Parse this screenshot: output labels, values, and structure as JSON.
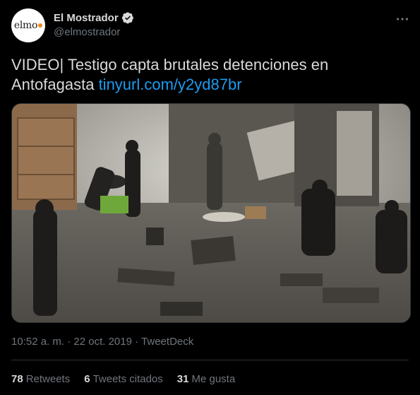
{
  "author": {
    "avatar_text": "elmo",
    "display_name": "El Mostrador",
    "handle": "@elmostrador"
  },
  "tweet": {
    "text": "VIDEO| Testigo capta brutales detenciones en Antofagasta",
    "link": "tinyurl.com/y2yd87br"
  },
  "meta": {
    "time": "10:52 a. m.",
    "separator": "·",
    "date": "22 oct. 2019",
    "source": "TweetDeck"
  },
  "stats": {
    "retweets_count": "78",
    "retweets_label": "Retweets",
    "quotes_count": "6",
    "quotes_label": "Tweets citados",
    "likes_count": "31",
    "likes_label": "Me gusta"
  },
  "icons": {
    "verified": "verified-badge-icon",
    "more": "more-options-icon"
  },
  "colors": {
    "background": "#000000",
    "text": "#d9d9d9",
    "secondary": "#6e767d",
    "link": "#1d9bf0",
    "border": "#2f3336",
    "brand_dot": "#f08a1c"
  }
}
